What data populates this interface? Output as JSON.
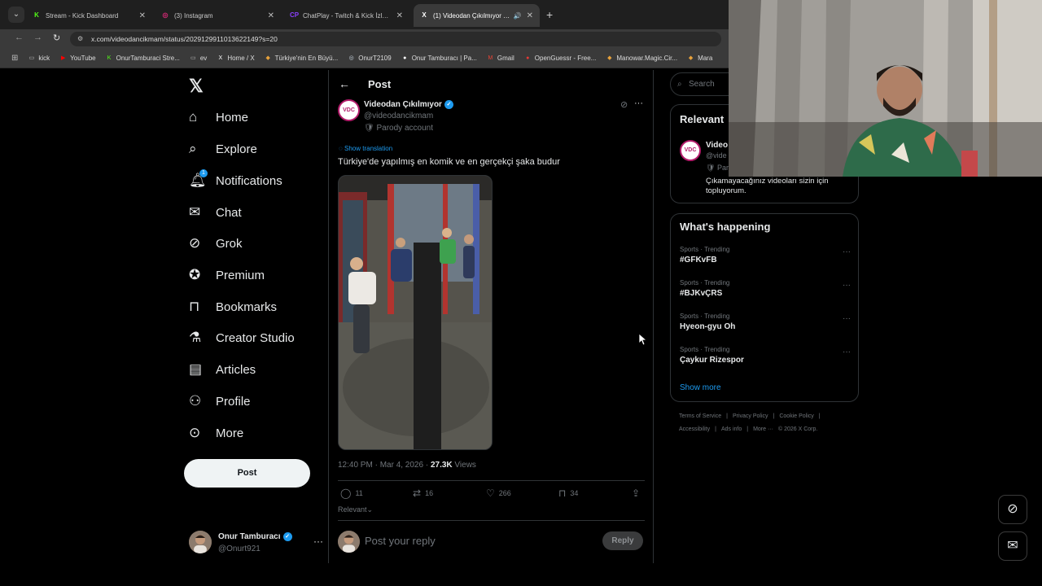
{
  "browser": {
    "tabs": [
      {
        "title": "Stream - Kick Dashboard",
        "active": false,
        "favicon_color": "#53fc18",
        "favicon": "K"
      },
      {
        "title": "(3) Instagram",
        "active": false,
        "favicon_color": "#d62976",
        "favicon": "◎"
      },
      {
        "title": "ChatPlay - Twitch & Kick İzleyici",
        "active": false,
        "favicon_color": "#8a3ffc",
        "favicon": "CP"
      },
      {
        "title": "(1) Videodan Çıkılmıyor on",
        "active": true,
        "favicon_color": "#000000",
        "favicon": "X"
      }
    ],
    "url": "x.com/videodancikmam/status/2029129911013622149?s=20",
    "bookmarks": [
      {
        "label": "kick",
        "icon": "folder-icon"
      },
      {
        "label": "YouTube",
        "icon": "youtube-icon"
      },
      {
        "label": "OnurTamburaci Stre...",
        "icon": "kick-icon"
      },
      {
        "label": "ev",
        "icon": "folder-icon"
      },
      {
        "label": "Home / X",
        "icon": "x-icon"
      },
      {
        "label": "Türkiye'nin En Büyü...",
        "icon": "site-icon"
      },
      {
        "label": "OnurT2109",
        "icon": "steam-icon"
      },
      {
        "label": "Onur Tamburacı | Pa...",
        "icon": "patreon-icon"
      },
      {
        "label": "Gmail",
        "icon": "gmail-icon"
      },
      {
        "label": "OpenGuessr - Free...",
        "icon": "openguessr-icon"
      },
      {
        "label": "Manowar.Magic.Cir...",
        "icon": "site-icon"
      },
      {
        "label": "Mara",
        "icon": "site-icon"
      }
    ]
  },
  "nav": {
    "items": [
      {
        "label": "Home",
        "icon": "home-icon"
      },
      {
        "label": "Explore",
        "icon": "search-icon"
      },
      {
        "label": "Notifications",
        "icon": "bell-icon",
        "badge": "1"
      },
      {
        "label": "Chat",
        "icon": "mail-icon"
      },
      {
        "label": "Grok",
        "icon": "grok-icon"
      },
      {
        "label": "Premium",
        "icon": "premium-icon"
      },
      {
        "label": "Bookmarks",
        "icon": "bookmark-icon"
      },
      {
        "label": "Creator Studio",
        "icon": "flask-icon"
      },
      {
        "label": "Articles",
        "icon": "article-icon"
      },
      {
        "label": "Profile",
        "icon": "person-icon"
      },
      {
        "label": "More",
        "icon": "more-circle-icon"
      }
    ],
    "post_button": "Post",
    "account": {
      "name": "Onur Tamburacı",
      "handle": "@Onurt921"
    }
  },
  "post": {
    "header": "Post",
    "author_name": "Videodan Çıkılmıyor",
    "author_handle": "@videodancikmam",
    "parody_label": "Parody account",
    "avatar_text": "VDC",
    "show_translation": "Show translation",
    "text": "Türkiye'de yapılmış en komik ve en gerçekçi şaka budur",
    "time": "12:40 PM · Mar 4, 2026 · ",
    "views_count": "27.3K",
    "views_label": " Views",
    "actions": {
      "replies": "11",
      "reposts": "16",
      "likes": "266",
      "bookmarks": "34"
    },
    "sort_label": "Relevant",
    "reply_placeholder": "Post your reply",
    "reply_button": "Reply"
  },
  "sidebar": {
    "search_placeholder": "Search",
    "relevant": {
      "title": "Relevant",
      "name": "Video",
      "handle": "@vide",
      "parody": "Par",
      "bio": "Çıkamayacağınız videoları sizin için topluyorum."
    },
    "whats_happening": {
      "title": "What's happening",
      "trends": [
        {
          "context": "Sports · Trending",
          "name": "#GFKvFB"
        },
        {
          "context": "Sports · Trending",
          "name": "#BJKvÇRS"
        },
        {
          "context": "Sports · Trending",
          "name": "Hyeon-gyu Oh"
        },
        {
          "context": "Sports · Trending",
          "name": "Çaykur Rizespor"
        }
      ],
      "show_more": "Show more"
    },
    "footer_line1": [
      "Terms of Service",
      "|",
      "Privacy Policy",
      "|",
      "Cookie Policy",
      "|"
    ],
    "footer_line2": [
      "Accessibility",
      "|",
      "Ads info",
      "|",
      "More ···",
      "© 2026 X Corp."
    ]
  },
  "colors": {
    "accent": "#1d9bf0",
    "background": "#000000",
    "border": "#2f3336",
    "muted_text": "#71767b"
  }
}
